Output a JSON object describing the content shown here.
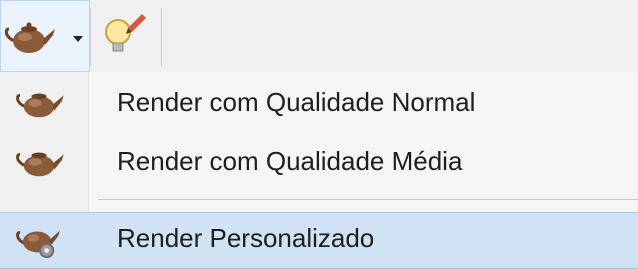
{
  "toolbar": {
    "render_button_icon": "teapot-icon",
    "dropdown_icon": "chevron-down-icon",
    "light_button_icon": "lightbulb-icon"
  },
  "menu": {
    "items": [
      {
        "label": "Render com Qualidade Normal",
        "icon": "teapot-icon"
      },
      {
        "label": "Render com Qualidade Média",
        "icon": "teapot-icon"
      },
      {
        "label": "Render Personalizado",
        "icon": "teapot-gear-icon",
        "highlighted": true
      }
    ]
  },
  "colors": {
    "highlight": "#cfe3f5",
    "highlight_border": "#a6c8e8",
    "teapot": "#8a5a3a",
    "bulb": "#e8c84a"
  }
}
